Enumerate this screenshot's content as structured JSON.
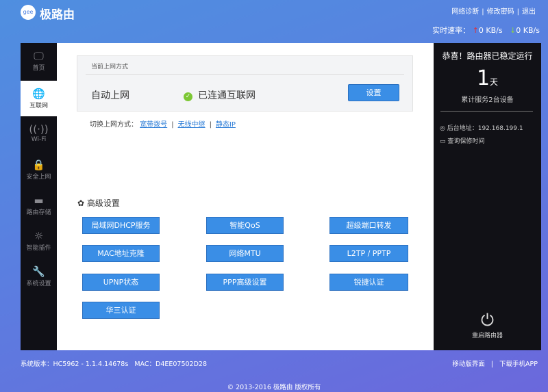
{
  "header": {
    "logo_text": "gee",
    "brand": "极路由",
    "links": [
      "网络诊断",
      "修改密码",
      "退出"
    ],
    "speed_label": "实时速率：",
    "upload": "0 KB/s",
    "download": "0 KB/s"
  },
  "sidebar": {
    "items": [
      {
        "label": "首页",
        "icon": "monitor-icon"
      },
      {
        "label": "互联网",
        "icon": "globe-icon",
        "active": true
      },
      {
        "label": "Wi-Fi",
        "icon": "wifi-icon"
      },
      {
        "label": "安全上网",
        "icon": "lock-icon"
      },
      {
        "label": "路由存储",
        "icon": "folder-icon"
      },
      {
        "label": "智能插件",
        "icon": "bulb-icon"
      },
      {
        "label": "系统设置",
        "icon": "wrench-icon"
      }
    ]
  },
  "main": {
    "card_title": "当前上网方式",
    "mode": "自动上网",
    "status": "已连通互联网",
    "settings_button": "设置",
    "switch_label": "切换上网方式：",
    "switch_links": [
      "宽带拨号",
      "无线中继",
      "静态IP"
    ],
    "advanced_title": "高级设置",
    "advanced_buttons": [
      "局域网DHCP服务",
      "智能QoS",
      "超级端口转发",
      "MAC地址克隆",
      "网络MTU",
      "L2TP / PPTP",
      "UPNP状态",
      "PPP高级设置",
      "锐捷认证",
      "华三认证"
    ]
  },
  "right": {
    "headline": "恭喜！路由器已稳定运行",
    "days": "1",
    "days_unit": "天",
    "served": "累计服务2台设备",
    "admin_address": "后台地址：192.168.199.1",
    "warranty": "查询保修时间",
    "reboot": "重启路由器"
  },
  "footer": {
    "version": "系统版本：HC5962 - 1.1.4.14678s",
    "mac": "MAC：D4EE07502D28",
    "links": [
      "移动版界面",
      "下载手机APP"
    ],
    "copyright": "© 2013-2016 极路由 版权所有"
  }
}
